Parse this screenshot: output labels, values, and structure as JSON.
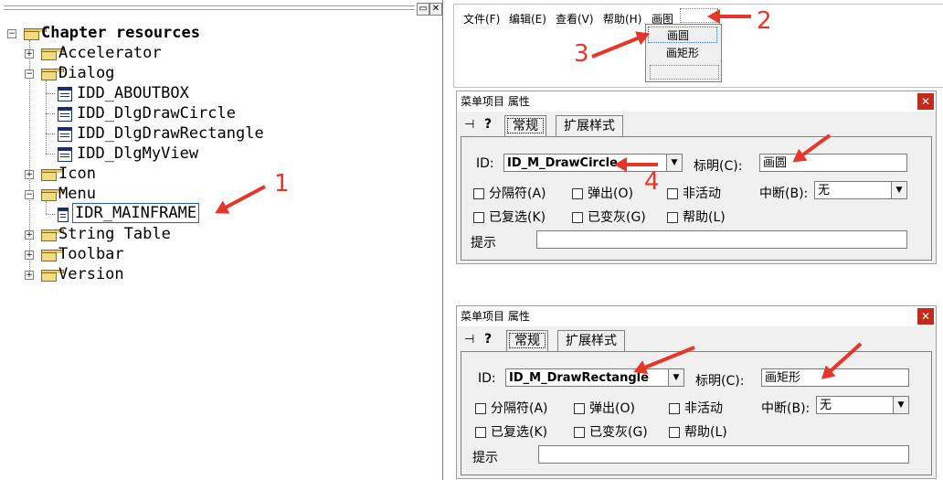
{
  "tree": {
    "root": "Chapter resources",
    "nodes": [
      "Accelerator",
      "Dialog",
      "IDD_ABOUTBOX",
      "IDD_DlgDrawCircle",
      "IDD_DlgDrawRectangle",
      "IDD_DlgMyView",
      "Icon",
      "Menu",
      "IDR_MAINFRAME",
      "String Table",
      "Toolbar",
      "Version"
    ],
    "selected": "IDR_MAINFRAME"
  },
  "menubar": {
    "items": [
      "文件(F)",
      "编辑(E)",
      "查看(V)",
      "帮助(H)",
      "画图"
    ],
    "popup_items": [
      "画圆",
      "画矩形"
    ]
  },
  "dialogs": [
    {
      "title": "菜单项目 属性",
      "tabs": [
        "常规",
        "扩展样式"
      ],
      "id_label": "ID:",
      "id_value": "ID_M_DrawCircle",
      "caption_label": "标明(C):",
      "caption_value": "画圆",
      "separator": "分隔符(A)",
      "popup": "弹出(O)",
      "inactive": "非活动",
      "break_label": "中断(B):",
      "break_value": "无",
      "checked": "已复选(K)",
      "grayed": "已变灰(G)",
      "help": "帮助(L)",
      "prompt_label": "提示"
    },
    {
      "title": "菜单项目 属性",
      "tabs": [
        "常规",
        "扩展样式"
      ],
      "id_label": "ID:",
      "id_value": "ID_M_DrawRectangle",
      "caption_label": "标明(C):",
      "caption_value": "画矩形",
      "separator": "分隔符(A)",
      "popup": "弹出(O)",
      "inactive": "非活动",
      "break_label": "中断(B):",
      "break_value": "无",
      "checked": "已复选(K)",
      "grayed": "已变灰(G)",
      "help": "帮助(L)",
      "prompt_label": "提示"
    }
  ],
  "annotations": [
    "1",
    "2",
    "3",
    "4"
  ],
  "colors": {
    "arrow": "#e8352a",
    "selection_border": "#1f5fbf"
  },
  "icons": {
    "pane_close": "close-icon",
    "pane_restore": "restore-icon",
    "pin": "pin-icon",
    "help": "help-icon"
  }
}
